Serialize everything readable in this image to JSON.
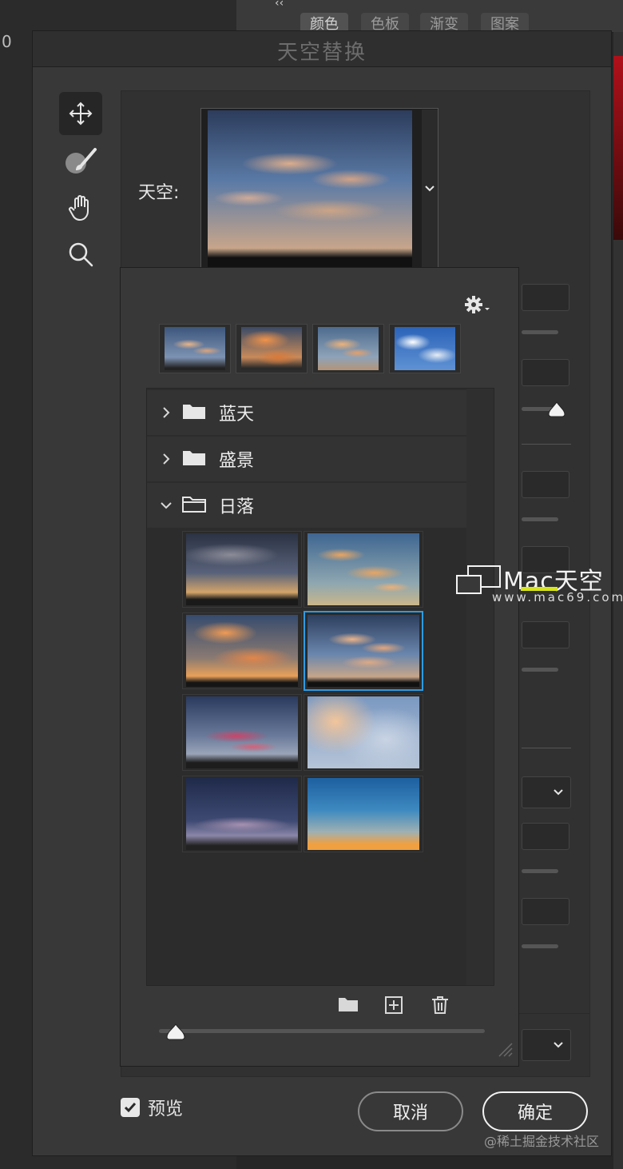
{
  "background": {
    "ruler_number": "0",
    "collapse_glyph": "‹‹",
    "panel_tabs": [
      "颜色",
      "色板",
      "渐变",
      "图案"
    ]
  },
  "dialog": {
    "title": "天空替换",
    "sky_label": "天空:",
    "preview_label": "预览",
    "cancel_label": "取消",
    "ok_label": "确定"
  },
  "tools": [
    "move-tool",
    "sky-brush-tool",
    "hand-tool",
    "zoom-tool"
  ],
  "popup": {
    "folders": [
      {
        "label": "蓝天",
        "expanded": false
      },
      {
        "label": "盛景",
        "expanded": false
      },
      {
        "label": "日落",
        "expanded": true
      }
    ],
    "footer_icons": [
      "new-folder-icon",
      "add-sky-icon",
      "trash-icon"
    ]
  },
  "watermark": {
    "brand": "Mac天空",
    "url": "www.mac69.com",
    "footer": "@稀土掘金技术社区"
  },
  "colors": {
    "selection": "#2f9be2",
    "dialog_bg": "#383838",
    "panel_bg": "#2c2c2c"
  }
}
